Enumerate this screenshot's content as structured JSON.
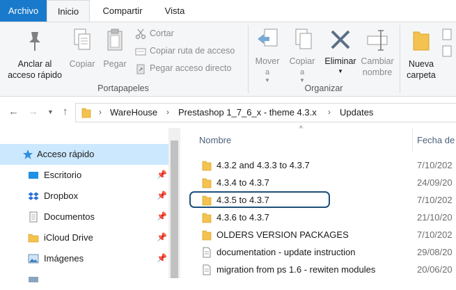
{
  "tabs": {
    "file": "Archivo",
    "home": "Inicio",
    "share": "Compartir",
    "view": "Vista"
  },
  "ribbon": {
    "pin": "Anclar al acceso rápido",
    "pin_l1": "Anclar al",
    "pin_l2": "acceso rápido",
    "copy": "Copiar",
    "paste": "Pegar",
    "cut": "Cortar",
    "copy_path": "Copiar ruta de acceso",
    "paste_shortcut": "Pegar acceso directo",
    "clipboard_group": "Portapapeles",
    "move_to_l1": "Mover",
    "move_to_l2": "a",
    "copy_to_l1": "Copiar",
    "copy_to_l2": "a",
    "delete": "Eliminar",
    "rename_l1": "Cambiar",
    "rename_l2": "nombre",
    "organize_group": "Organizar",
    "new_folder_l1": "Nueva",
    "new_folder_l2": "carpeta"
  },
  "address": {
    "crumbs": [
      "WareHouse",
      "Prestashop 1_7_6_x - theme 4.3.x",
      "Updates"
    ]
  },
  "nav": {
    "items": [
      {
        "label": "Acceso rápido"
      },
      {
        "label": "Escritorio"
      },
      {
        "label": "Dropbox"
      },
      {
        "label": "Documentos"
      },
      {
        "label": "iCloud Drive"
      },
      {
        "label": "Imágenes"
      }
    ]
  },
  "list": {
    "col_name": "Nombre",
    "col_date": "Fecha de",
    "rows": [
      {
        "name": "4.3.2 and 4.3.3 to 4.3.7",
        "date": "7/10/202",
        "type": "folder"
      },
      {
        "name": "4.3.4 to 4.3.7",
        "date": "24/09/20",
        "type": "folder"
      },
      {
        "name": "4.3.5 to 4.3.7",
        "date": "7/10/202",
        "type": "folder"
      },
      {
        "name": "4.3.6 to 4.3.7",
        "date": "21/10/20",
        "type": "folder"
      },
      {
        "name": "OLDERS VERSION PACKAGES",
        "date": "7/10/202",
        "type": "folder"
      },
      {
        "name": "documentation - update instruction",
        "date": "29/08/20",
        "type": "file"
      },
      {
        "name": "migration from ps 1.6 - rewiten modules",
        "date": "20/06/20",
        "type": "file"
      }
    ]
  },
  "colors": {
    "accent": "#1979ca",
    "selected": "#cce8ff",
    "folder": "#e8b53c",
    "highlight": "#1b4f7a"
  }
}
